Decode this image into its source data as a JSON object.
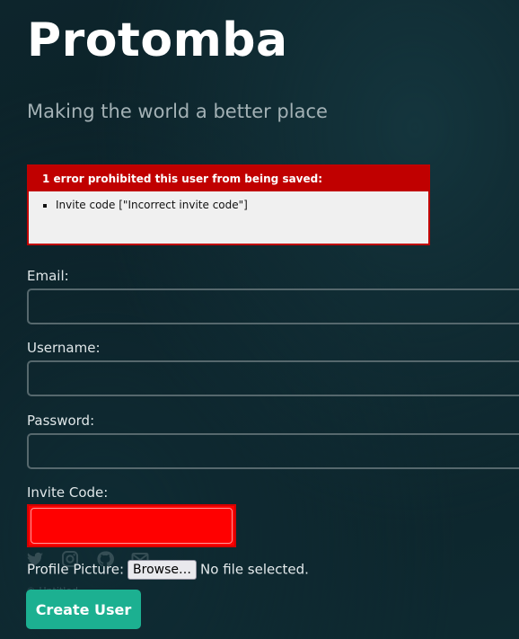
{
  "site": {
    "title": "Protomba",
    "tagline": "Making the world a better place"
  },
  "errors": {
    "heading": "1 error prohibited this user from being saved:",
    "items": [
      "Invite code [\"Incorrect invite code\"]"
    ]
  },
  "form": {
    "email": {
      "label": "Email:",
      "value": ""
    },
    "username": {
      "label": "Username:",
      "value": ""
    },
    "password": {
      "label": "Password:",
      "value": ""
    },
    "invite_code": {
      "label": "Invite Code:",
      "value": ""
    },
    "profile_picture": {
      "label": "Profile Picture:",
      "browse_label": "Browse…",
      "status": "No file selected."
    },
    "submit_label": "Create User"
  },
  "footer": {
    "icons": [
      "twitter-icon",
      "instagram-icon",
      "github-icon",
      "email-icon"
    ],
    "copyright": "© Untitled."
  },
  "colors": {
    "error_red": "#c00000",
    "invite_field_red": "#ff0000",
    "accent": "#1cb091",
    "background": "#0d252c"
  }
}
